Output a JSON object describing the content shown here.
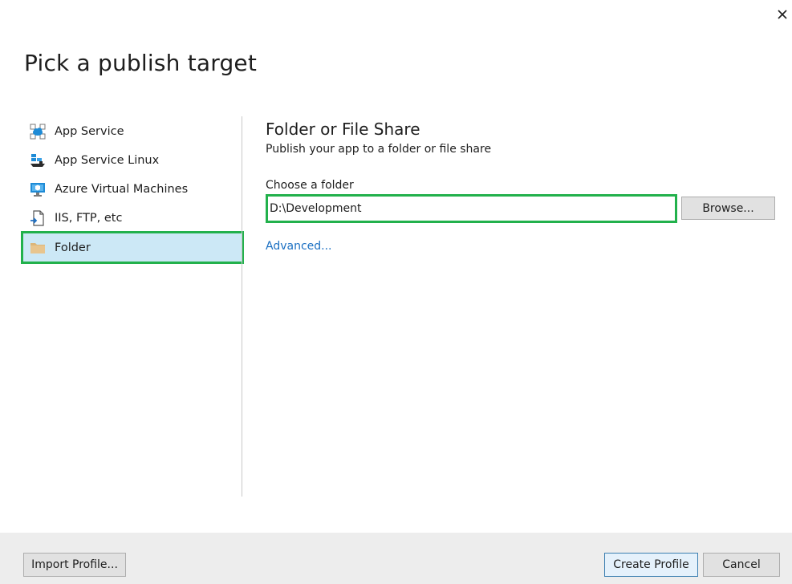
{
  "dialog": {
    "title": "Pick a publish target",
    "close_icon": "close-icon"
  },
  "targets": [
    {
      "label": "App Service",
      "icon": "app-service-icon",
      "selected": false
    },
    {
      "label": "App Service Linux",
      "icon": "app-service-linux-icon",
      "selected": false
    },
    {
      "label": "Azure Virtual Machines",
      "icon": "virtual-machine-icon",
      "selected": false
    },
    {
      "label": "IIS, FTP, etc",
      "icon": "iis-ftp-icon",
      "selected": false
    },
    {
      "label": "Folder",
      "icon": "folder-icon",
      "selected": true
    }
  ],
  "panel": {
    "title": "Folder or File Share",
    "subtitle": "Publish your app to a folder or file share",
    "folder_label": "Choose a folder",
    "folder_value": "D:\\Development",
    "browse_label": "Browse...",
    "advanced_label": "Advanced..."
  },
  "footer": {
    "import_label": "Import Profile...",
    "create_label": "Create Profile",
    "cancel_label": "Cancel"
  },
  "colors": {
    "highlight_outline": "#22b14c",
    "selected_bg": "#cce8f6",
    "link": "#1a6fc2"
  }
}
